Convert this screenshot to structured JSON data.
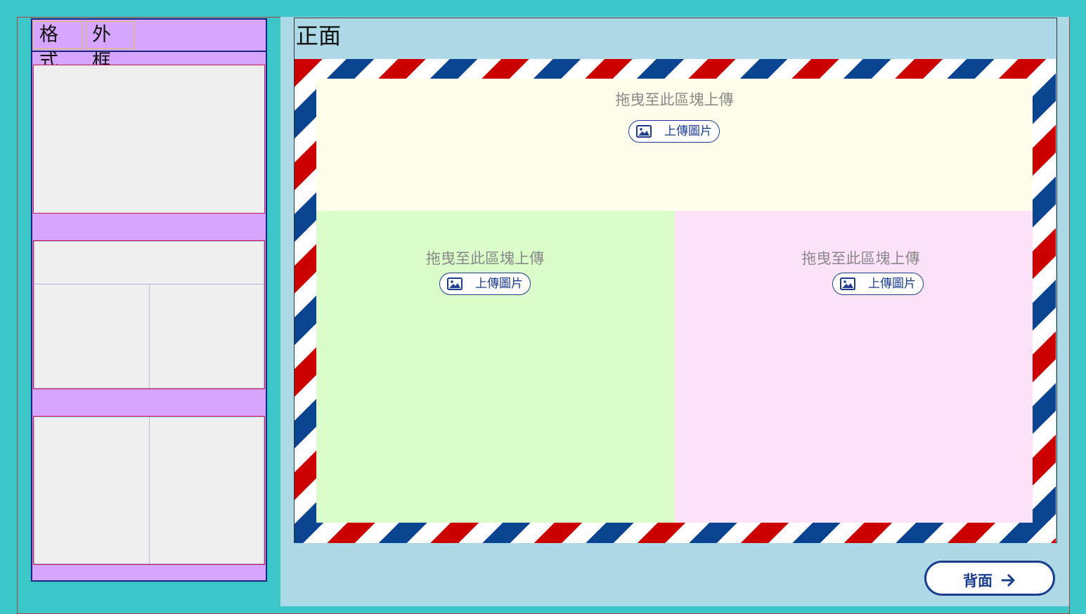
{
  "tabs": [
    {
      "label": "格式"
    },
    {
      "label": "外框"
    }
  ],
  "face": {
    "title": "正面"
  },
  "dropzones": {
    "top": {
      "hint": "拖曳至此區塊上傳",
      "button": "上傳圖片"
    },
    "left": {
      "hint": "拖曳至此區塊上傳",
      "button": "上傳圖片"
    },
    "right": {
      "hint": "拖曳至此區塊上傳",
      "button": "上傳圖片"
    }
  },
  "navigation": {
    "back_label": "背面",
    "back_icon": "arrow-right-icon"
  },
  "layout_options": [
    {
      "name": "single-photo"
    },
    {
      "name": "one-top-two-bottom"
    },
    {
      "name": "two-side-by-side"
    }
  ],
  "colors": {
    "page_bg": "#3cc6c8",
    "panel_bg": "#d6a6ff",
    "workspace_bg": "#add8e6",
    "zone_top": "#fffeea",
    "zone_left": "#dafdca",
    "zone_right": "#fde2fa",
    "airmail_red": "#cc0000",
    "airmail_blue": "#0a4491",
    "accent": "#1a3d8f"
  }
}
